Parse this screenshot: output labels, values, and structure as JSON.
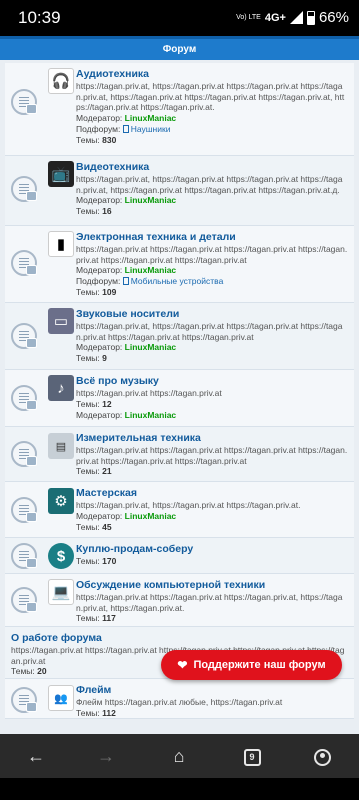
{
  "status_bar": {
    "time": "10:39",
    "lte": "Vo) LTE",
    "network": "4G+",
    "battery": "66%"
  },
  "header": {
    "title": "Форум"
  },
  "donate": {
    "label": "Поддержите наш форум"
  },
  "forums": [
    {
      "title": "Аудиотехника",
      "icon": "headphones-icon",
      "description": "https://tagan.priv.at, https://tagan.priv.at https://tagan.priv.at https://tagan.priv.at, https://tagan.priv.at https://tagan.priv.at https://tagan.priv.at, https://tagan.priv.at https://tagan.priv.at.",
      "moderator_label": "Модератор:",
      "moderator": "LinuxManiac",
      "subforum_label": "Подфорум:",
      "subforum": "Наушники",
      "topics_label": "Темы:",
      "topics": "830"
    },
    {
      "title": "Видеотехника",
      "icon": "tv-icon",
      "description": "https://tagan.priv.at, https://tagan.priv.at https://tagan.priv.at https://tagan.priv.at, https://tagan.priv.at https://tagan.priv.at https://tagan.priv.at.д.",
      "moderator_label": "Модератор:",
      "moderator": "LinuxManiac",
      "topics_label": "Темы:",
      "topics": "16"
    },
    {
      "title": "Электронная техника и детали",
      "icon": "transistor-icon",
      "description": "https://tagan.priv.at https://tagan.priv.at https://tagan.priv.at https://tagan.priv.at https://tagan.priv.at https://tagan.priv.at",
      "moderator_label": "Модератор:",
      "moderator": "LinuxManiac",
      "subforum_label": "Подфорум:",
      "subforum": "Мобильные устройства",
      "topics_label": "Темы:",
      "topics": "109"
    },
    {
      "title": "Звуковые носители",
      "icon": "cassette-icon",
      "description": "https://tagan.priv.at, https://tagan.priv.at https://tagan.priv.at https://tagan.priv.at https://tagan.priv.at https://tagan.priv.at",
      "moderator_label": "Модератор:",
      "moderator": "LinuxManiac",
      "topics_label": "Темы:",
      "topics": "9"
    },
    {
      "title": "Всё про музыку",
      "icon": "music-icon",
      "description": "https://tagan.priv.at https://tagan.priv.at",
      "moderator_label": "Модератор:",
      "moderator": "LinuxManiac",
      "topics_label": "Темы:",
      "topics": "12"
    },
    {
      "title": "Измерительная техника",
      "icon": "meter-icon",
      "description": "https://tagan.priv.at https://tagan.priv.at https://tagan.priv.at https://tagan.priv.at https://tagan.priv.at https://tagan.priv.at",
      "topics_label": "Темы:",
      "topics": "21"
    },
    {
      "title": "Мастерская",
      "icon": "tools-icon",
      "description": "https://tagan.priv.at, https://tagan.priv.at https://tagan.priv.at.",
      "moderator_label": "Модератор:",
      "moderator": "LinuxManiac",
      "topics_label": "Темы:",
      "topics": "45"
    },
    {
      "title": "Куплю-продам-соберу",
      "icon": "dollar-icon",
      "topics_label": "Темы:",
      "topics": "170"
    },
    {
      "title": "Обсуждение компьютерной техники",
      "icon": "computer-icon",
      "description": "https://tagan.priv.at https://tagan.priv.at https://tagan.priv.at, https://tagan.priv.at, https://tagan.priv.at.",
      "topics_label": "Темы:",
      "topics": "117"
    },
    {
      "title": "О работе форума",
      "description": "https://tagan.priv.at https://tagan.priv.at https://tagan.priv.at https://tagan.priv.at https://tagan.priv.at",
      "topics_label": "Темы:",
      "topics": "20"
    },
    {
      "title": "Флейм",
      "icon": "flame-icon",
      "description": "Флейм https://tagan.priv.at любые, https://tagan.priv.at",
      "topics_label": "Темы:",
      "topics": "112"
    }
  ],
  "colors": {
    "header": "#1e7bcc",
    "title": "#125b9c",
    "moderator": "#0a9a0a",
    "donate": "#e0121c"
  }
}
